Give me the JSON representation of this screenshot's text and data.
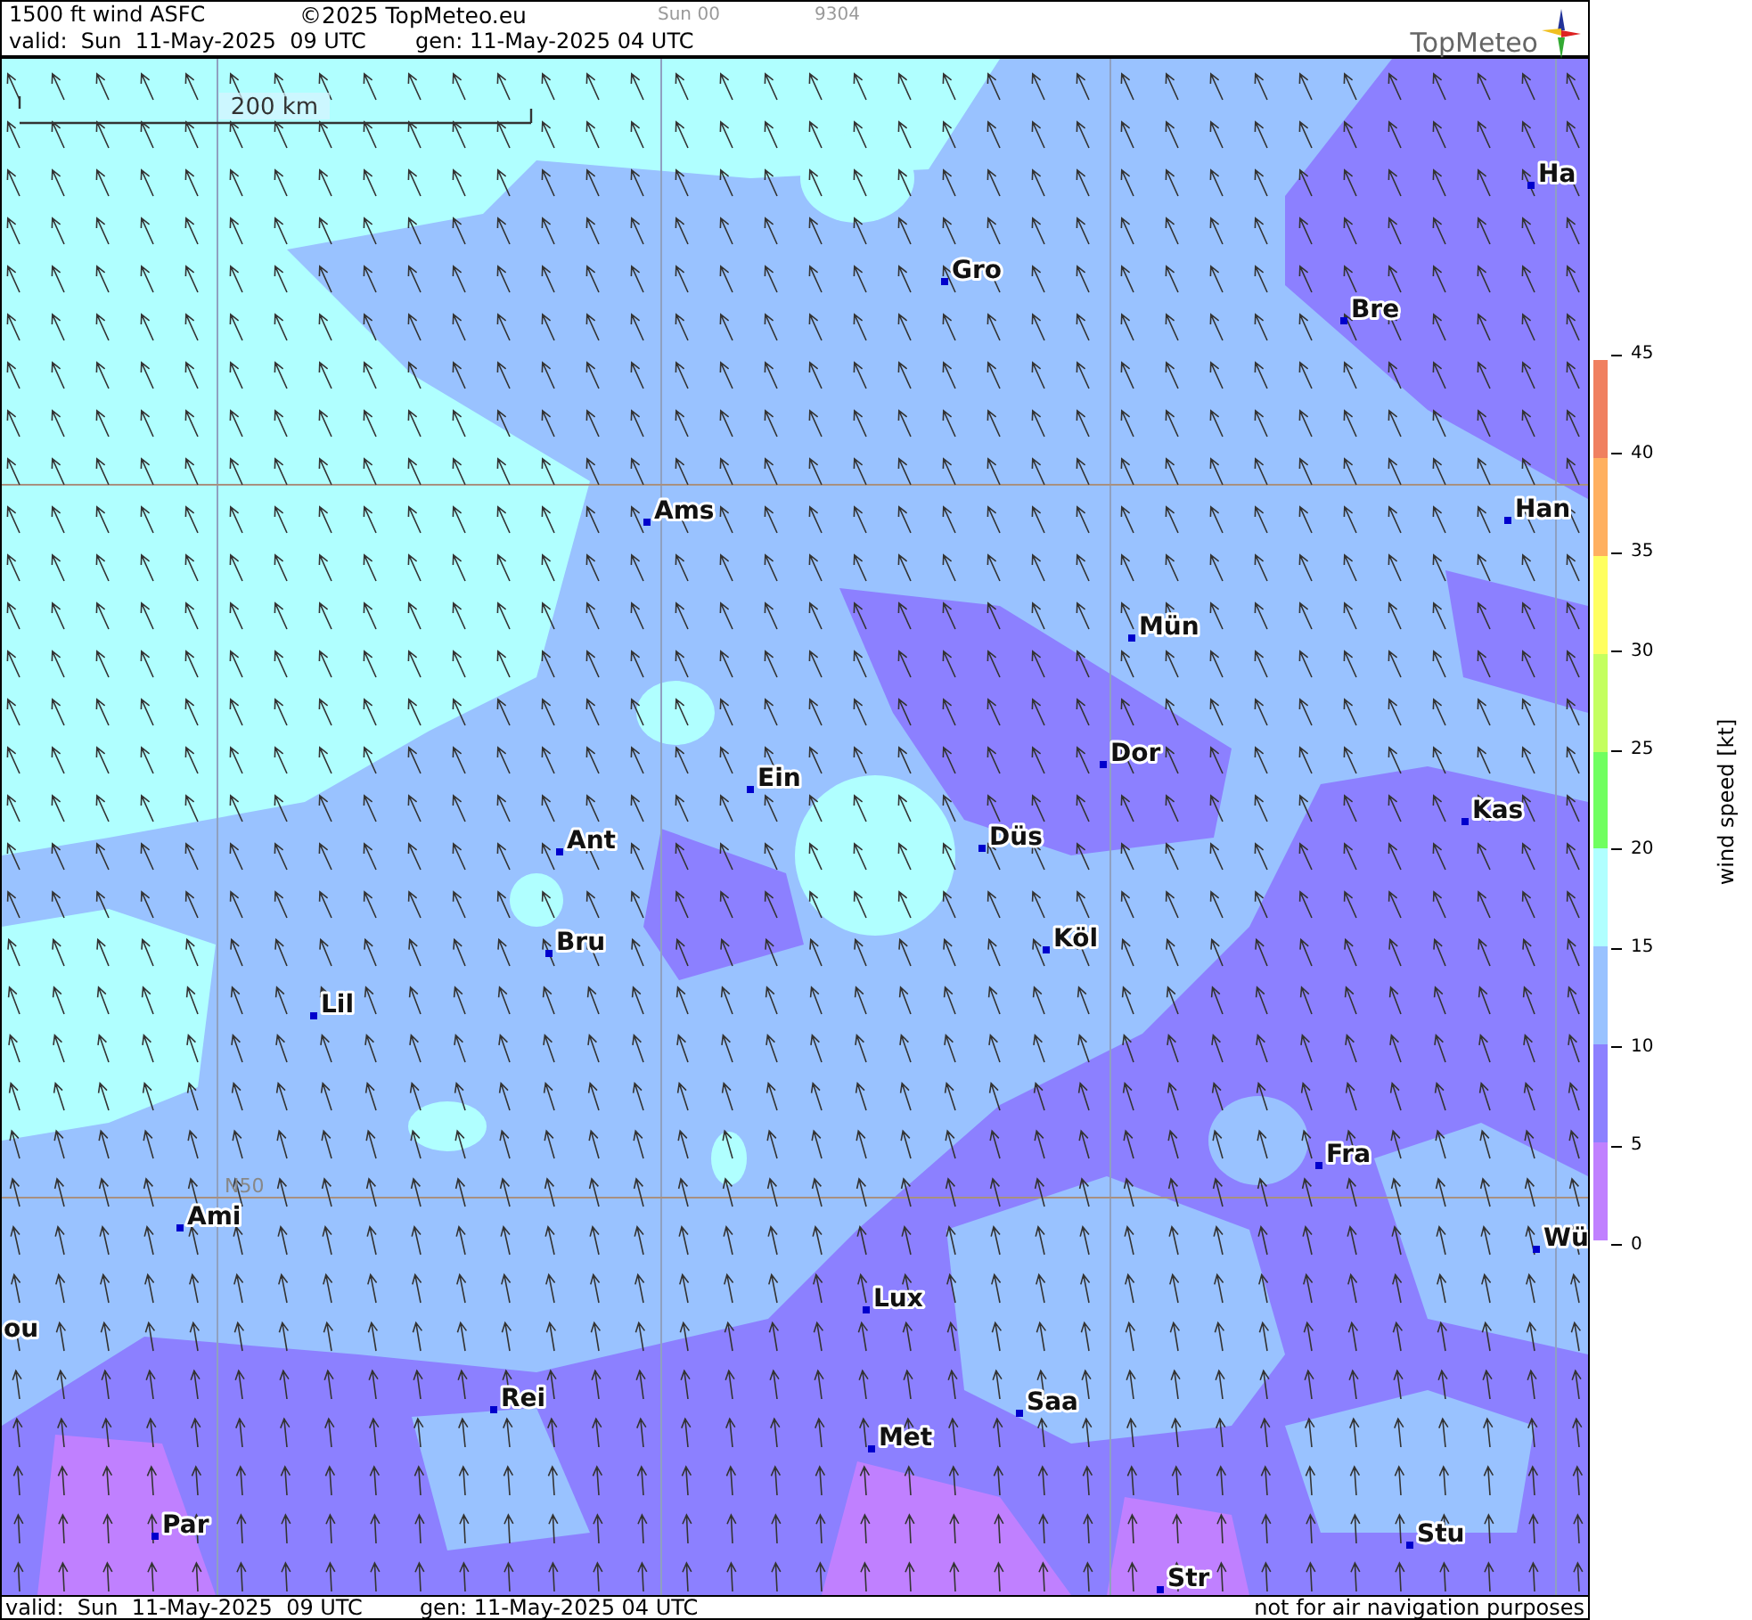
{
  "header": {
    "title": "1500 ft wind ASFC",
    "copyright": "©2025 TopMeteo.eu",
    "run": "Sun 00",
    "code": "9304",
    "valid": "valid:  Sun  11-May-2025  09 UTC",
    "generated": "gen: 11-May-2025 04 UTC",
    "logo": "TopMeteo"
  },
  "map": {
    "scale_label": "200 km",
    "grid_label": "N50",
    "cities": [
      "Ha",
      "Gro",
      "Bre",
      "Ams",
      "Han",
      "Mün",
      "Dor",
      "Ein",
      "Kas",
      "Ant",
      "Düs",
      "Bru",
      "Köl",
      "Lil",
      "Fra",
      "Ami",
      "Wü",
      "Lux",
      "ou",
      "Rei",
      "Saa",
      "Met",
      "Par",
      "Stu",
      "Str"
    ]
  },
  "legend": {
    "title": "wind speed [kt]",
    "ticks": [
      "45",
      "40",
      "35",
      "30",
      "25",
      "20",
      "15",
      "10",
      "5",
      "0"
    ],
    "bins": [
      {
        "color": "#f08060"
      },
      {
        "color": "#ffb060"
      },
      {
        "color": "#ffff60"
      },
      {
        "color": "#c4ff60"
      },
      {
        "color": "#70ff60"
      },
      {
        "color": "#b0ffff"
      },
      {
        "color": "#99c2ff"
      },
      {
        "color": "#8c80ff"
      },
      {
        "color": "#c080ff"
      }
    ]
  },
  "footer": {
    "valid": "valid:  Sun  11-May-2025  09 UTC",
    "generated": "gen: 11-May-2025 04 UTC",
    "note": "not for air navigation purposes"
  }
}
